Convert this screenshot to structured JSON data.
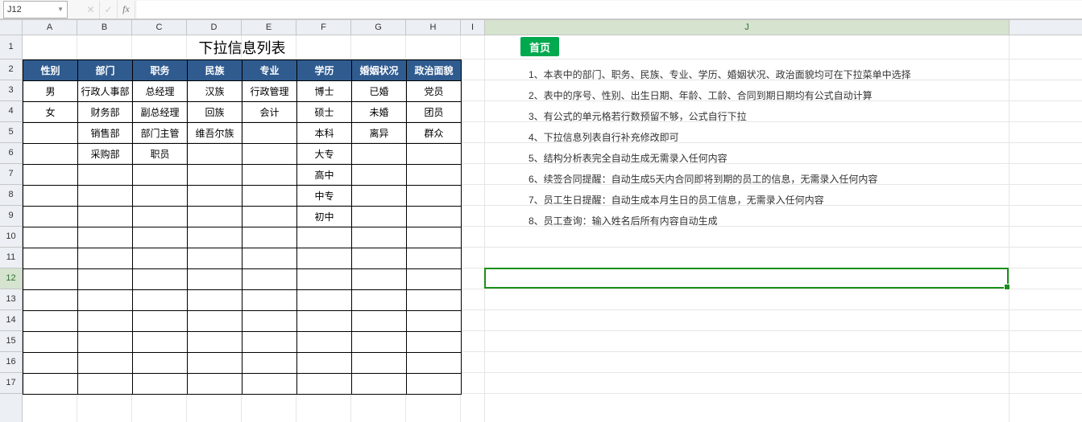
{
  "name_box": "J12",
  "formula_value": "",
  "columns": [
    "A",
    "B",
    "C",
    "D",
    "E",
    "F",
    "G",
    "H",
    "I",
    "J"
  ],
  "row_count": 17,
  "title": "下拉信息列表",
  "headers": [
    "性别",
    "部门",
    "职务",
    "民族",
    "专业",
    "学历",
    "婚姻状况",
    "政治面貌"
  ],
  "rows": [
    [
      "男",
      "行政人事部",
      "总经理",
      "汉族",
      "行政管理",
      "博士",
      "已婚",
      "党员"
    ],
    [
      "女",
      "财务部",
      "副总经理",
      "回族",
      "会计",
      "硕士",
      "未婚",
      "团员"
    ],
    [
      "",
      "销售部",
      "部门主管",
      "维吾尔族",
      "",
      "本科",
      "离异",
      "群众"
    ],
    [
      "",
      "采购部",
      "职员",
      "",
      "",
      "大专",
      "",
      ""
    ],
    [
      "",
      "",
      "",
      "",
      "",
      "高中",
      "",
      ""
    ],
    [
      "",
      "",
      "",
      "",
      "",
      "中专",
      "",
      ""
    ],
    [
      "",
      "",
      "",
      "",
      "",
      "初中",
      "",
      ""
    ],
    [
      "",
      "",
      "",
      "",
      "",
      "",
      "",
      ""
    ],
    [
      "",
      "",
      "",
      "",
      "",
      "",
      "",
      ""
    ],
    [
      "",
      "",
      "",
      "",
      "",
      "",
      "",
      ""
    ],
    [
      "",
      "",
      "",
      "",
      "",
      "",
      "",
      ""
    ],
    [
      "",
      "",
      "",
      "",
      "",
      "",
      "",
      ""
    ],
    [
      "",
      "",
      "",
      "",
      "",
      "",
      "",
      ""
    ],
    [
      "",
      "",
      "",
      "",
      "",
      "",
      "",
      ""
    ],
    [
      "",
      "",
      "",
      "",
      "",
      "",
      "",
      ""
    ]
  ],
  "homepage_label": "首页",
  "notes": [
    "1、本表中的部门、职务、民族、专业、学历、婚姻状况、政治面貌均可在下拉菜单中选择",
    "2、表中的序号、性别、出生日期、年龄、工龄、合同到期日期均有公式自动计算",
    "3、有公式的单元格若行数预留不够，公式自行下拉",
    "4、下拉信息列表自行补充修改即可",
    "5、结构分析表完全自动生成无需录入任何内容",
    "6、续签合同提醒：自动生成5天内合同即将到期的员工的信息，无需录入任何内容",
    "7、员工生日提醒：自动生成本月生日的员工信息，无需录入任何内容",
    "8、员工查询：输入姓名后所有内容自动生成"
  ],
  "selection": {
    "col": "J",
    "row": 12
  },
  "colors": {
    "header_bg": "#2f5b8f",
    "accent": "#1a8f1a",
    "home_btn": "#00a84e"
  }
}
